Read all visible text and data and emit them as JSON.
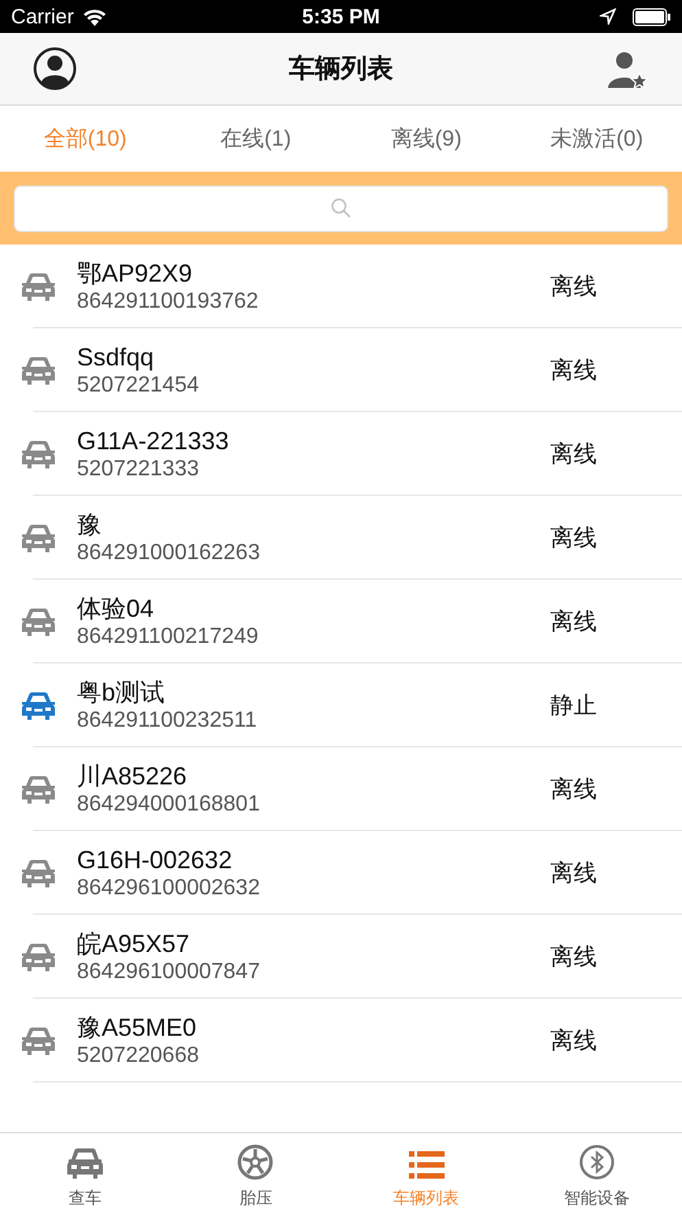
{
  "status_bar": {
    "carrier": "Carrier",
    "time": "5:35 PM"
  },
  "nav": {
    "title": "车辆列表"
  },
  "tabs": [
    {
      "label": "全部(10)",
      "selected": true
    },
    {
      "label": "在线(1)",
      "selected": false
    },
    {
      "label": "离线(9)",
      "selected": false
    },
    {
      "label": "未激活(0)",
      "selected": false
    }
  ],
  "vehicles": [
    {
      "name": "鄂AP92X9",
      "id": "864291100193762",
      "status": "离线",
      "color": "#8a8a8a"
    },
    {
      "name": "Ssdfqq",
      "id": "5207221454",
      "status": "离线",
      "color": "#8a8a8a"
    },
    {
      "name": "G11A-221333",
      "id": "5207221333",
      "status": "离线",
      "color": "#8a8a8a"
    },
    {
      "name": "豫",
      "id": "864291000162263",
      "status": "离线",
      "color": "#8a8a8a"
    },
    {
      "name": "体验04",
      "id": "864291100217249",
      "status": "离线",
      "color": "#8a8a8a"
    },
    {
      "name": "粤b测试",
      "id": "864291100232511",
      "status": "静止",
      "color": "#1f78c8"
    },
    {
      "name": "川A85226",
      "id": "864294000168801",
      "status": "离线",
      "color": "#8a8a8a"
    },
    {
      "name": "G16H-002632",
      "id": "864296100002632",
      "status": "离线",
      "color": "#8a8a8a"
    },
    {
      "name": "皖A95X57",
      "id": "864296100007847",
      "status": "离线",
      "color": "#8a8a8a"
    },
    {
      "name": "豫A55ME0",
      "id": "5207220668",
      "status": "离线",
      "color": "#8a8a8a"
    }
  ],
  "tab_bar": [
    {
      "label": "查车",
      "kind": "car",
      "selected": false
    },
    {
      "label": "胎压",
      "kind": "wheel",
      "selected": false
    },
    {
      "label": "车辆列表",
      "kind": "list",
      "selected": true
    },
    {
      "label": "智能设备",
      "kind": "bluetooth",
      "selected": false
    }
  ]
}
